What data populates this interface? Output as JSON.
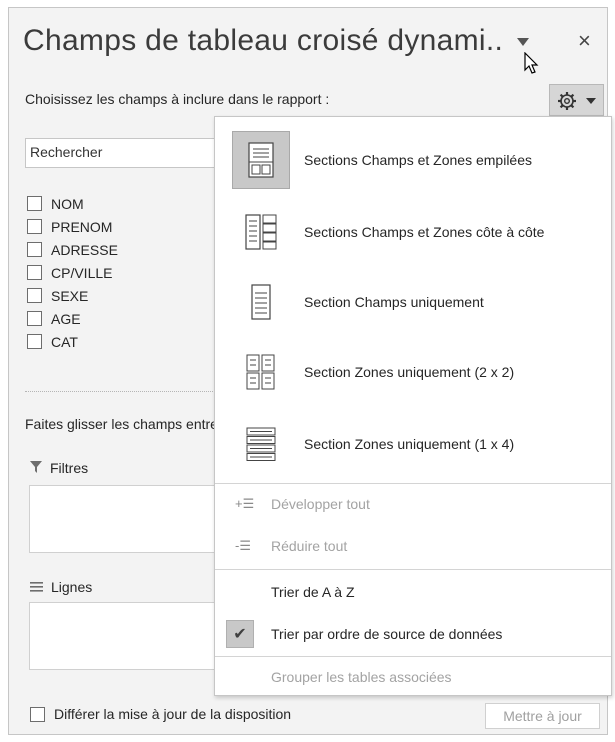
{
  "pane": {
    "title": "Champs de tableau croisé dynami..",
    "close_symbol": "×",
    "subtitle": "Choisissez les champs à inclure dans le rapport :",
    "search_placeholder": "Rechercher",
    "fields": [
      "NOM",
      "PRENOM",
      "ADRESSE",
      "CP/VILLE",
      "SEXE",
      "AGE",
      "CAT"
    ],
    "drag_label": "Faites glisser les champs entre les zones ci-dessous :",
    "areas": {
      "filters_label": "Filtres",
      "rows_label": "Lignes"
    },
    "defer_label": "Différer la mise à jour de la disposition",
    "update_button": "Mettre à jour"
  },
  "menu": {
    "layout_options": [
      {
        "label": "Sections Champs et Zones empilées",
        "icon": "stacked-layout-icon",
        "selected": true
      },
      {
        "label": "Sections Champs et Zones côte à côte",
        "icon": "side-by-side-layout-icon",
        "selected": false
      },
      {
        "label": "Section Champs uniquement",
        "icon": "fields-only-icon",
        "selected": false
      },
      {
        "label": "Section Zones uniquement (2 x 2)",
        "icon": "areas-2x2-icon",
        "selected": false
      },
      {
        "label": "Section Zones uniquement (1 x 4)",
        "icon": "areas-1x4-icon",
        "selected": false
      }
    ],
    "expand_all": "Développer tout",
    "collapse_all": "Réduire tout",
    "sort_az": "Trier de A à Z",
    "sort_source": "Trier par ordre de source de données",
    "group_tables": "Grouper les tables associées"
  }
}
